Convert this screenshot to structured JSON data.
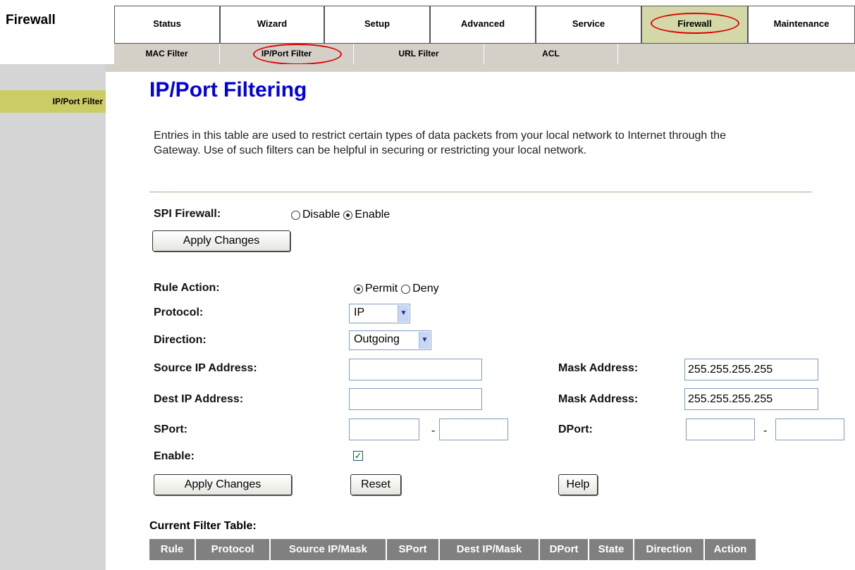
{
  "header": {
    "section_title": "Firewall",
    "main_tabs": [
      {
        "label": "Status",
        "active": false
      },
      {
        "label": "Wizard",
        "active": false
      },
      {
        "label": "Setup",
        "active": false
      },
      {
        "label": "Advanced",
        "active": false
      },
      {
        "label": "Service",
        "active": false
      },
      {
        "label": "Firewall",
        "active": true
      },
      {
        "label": "Maintenance",
        "active": false
      }
    ],
    "sub_tabs": [
      {
        "label": "MAC Filter"
      },
      {
        "label": "IP/Port Filter",
        "active": true
      },
      {
        "label": "URL Filter"
      },
      {
        "label": "ACL"
      }
    ]
  },
  "sidebar": {
    "items": [
      {
        "label": "IP/Port Filter",
        "active": true
      }
    ]
  },
  "main": {
    "title": "IP/Port Filtering",
    "description": "Entries in this table are used to restrict certain types of data packets from your local network to Internet through the Gateway. Use of such filters can be helpful in securing or restricting your local network.",
    "spi": {
      "label": "SPI Firewall:",
      "options": [
        "Disable",
        "Enable"
      ],
      "selected": "Enable",
      "apply_label": "Apply Changes"
    },
    "form": {
      "rule_action_label": "Rule Action:",
      "rule_action_options": [
        "Permit",
        "Deny"
      ],
      "rule_action_selected": "Permit",
      "protocol_label": "Protocol:",
      "protocol_value": "IP",
      "direction_label": "Direction:",
      "direction_value": "Outgoing",
      "source_ip_label": "Source IP Address:",
      "source_ip_value": "",
      "source_mask_label": "Mask Address:",
      "source_mask_value": "255.255.255.255",
      "dest_ip_label": "Dest IP Address:",
      "dest_ip_value": "",
      "dest_mask_label": "Mask Address:",
      "dest_mask_value": "255.255.255.255",
      "sport_label": "SPort:",
      "dport_label": "DPort:",
      "range_separator": "-",
      "enable_label": "Enable:",
      "enable_checked": true,
      "apply_label": "Apply Changes",
      "reset_label": "Reset",
      "help_label": "Help"
    },
    "table": {
      "title": "Current Filter Table:",
      "columns": [
        "Rule",
        "Protocol",
        "Source IP/Mask",
        "SPort",
        "Dest IP/Mask",
        "DPort",
        "State",
        "Direction",
        "Action"
      ]
    }
  },
  "colors": {
    "title_blue": "#0000e0",
    "active_tab": "#d4d8a8",
    "highlight_red": "#e00000",
    "sidebar_active": "#cccc66",
    "table_header": "#808080"
  }
}
